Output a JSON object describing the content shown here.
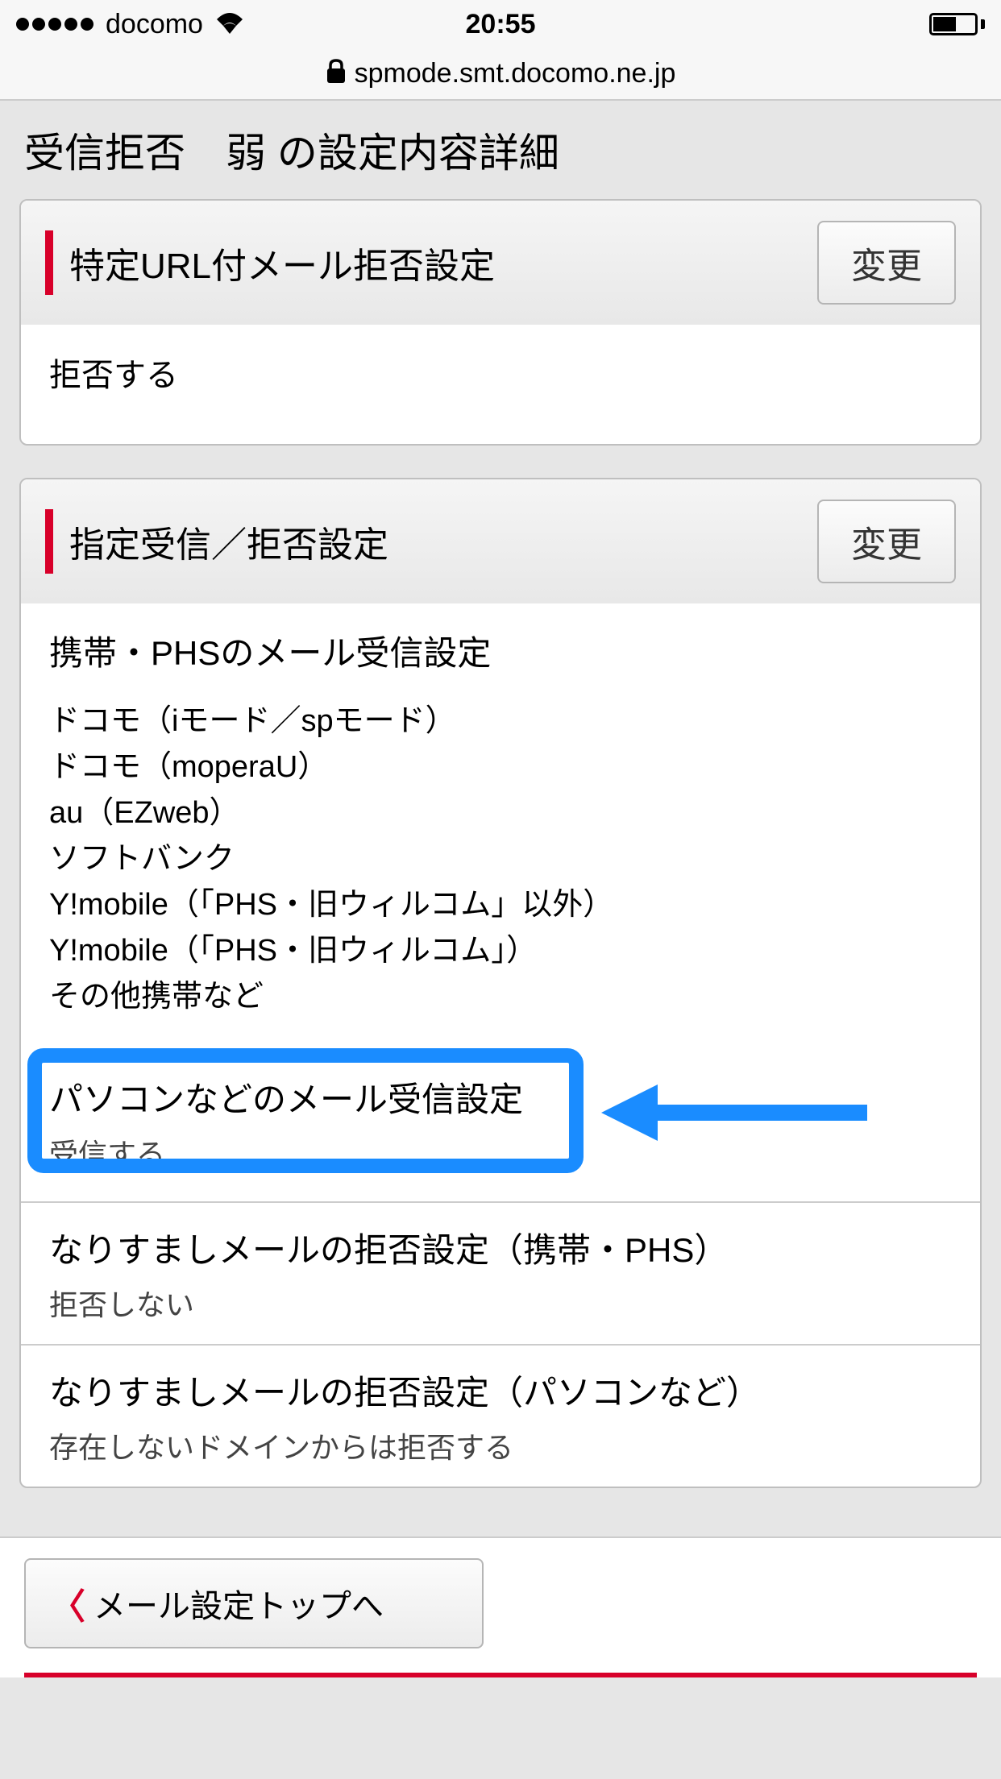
{
  "status_bar": {
    "carrier": "docomo",
    "time": "20:55"
  },
  "url": "spmode.smt.docomo.ne.jp",
  "page_title": "受信拒否　弱 の設定内容詳細",
  "card1": {
    "title": "特定URL付メール拒否設定",
    "button": "変更",
    "value": "拒否する"
  },
  "card2": {
    "title": "指定受信／拒否設定",
    "button": "変更",
    "section1": {
      "title": "携帯・PHSのメール受信設定",
      "items": [
        "ドコモ（iモード／spモード）",
        "ドコモ（moperaU）",
        "au（EZweb）",
        "ソフトバンク",
        "Y!mobile（「PHS・旧ウィルコム」以外）",
        "Y!mobile（「PHS・旧ウィルコム」）",
        "その他携帯など"
      ]
    },
    "section2": {
      "title": "パソコンなどのメール受信設定",
      "value": "受信する"
    },
    "section3": {
      "title": "なりすましメールの拒否設定（携帯・PHS）",
      "value": "拒否しない"
    },
    "section4": {
      "title": "なりすましメールの拒否設定（パソコンなど）",
      "value": "存在しないドメインからは拒否する"
    }
  },
  "nav": {
    "back": "メール設定トップへ"
  }
}
